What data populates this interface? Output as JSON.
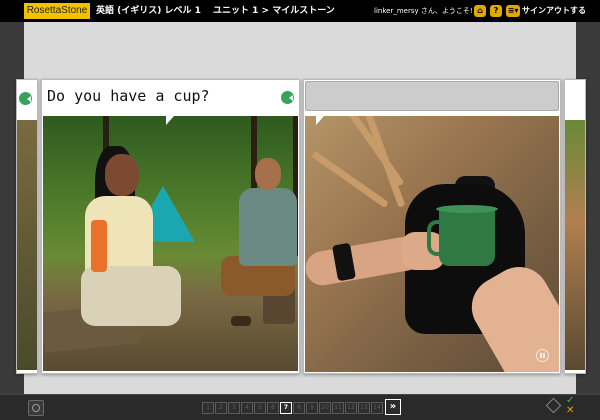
{
  "header": {
    "logo": "RosettaStone",
    "course": "英語 (イギリス) レベル 1",
    "unit": "ユニット 1 > マイルストーン",
    "greeting": "linker_mersy さん、ようこそ!",
    "home_icon": "home-icon",
    "help_label": "?",
    "menu_label": "≡▾",
    "signout": "サインアウトする"
  },
  "cards": [
    {
      "caption": "Do you have a cup?",
      "role": "prompt"
    },
    {
      "caption": "",
      "role": "answer"
    }
  ],
  "pager": {
    "pages": [
      "1",
      "2",
      "3",
      "4",
      "5",
      "6",
      "7",
      "8",
      "9",
      "10",
      "11",
      "12",
      "13",
      "14"
    ],
    "current": "7",
    "next_label": "»"
  },
  "colors": {
    "accent": "#f2c200",
    "audio": "#35a35a",
    "background": "#dadada"
  }
}
